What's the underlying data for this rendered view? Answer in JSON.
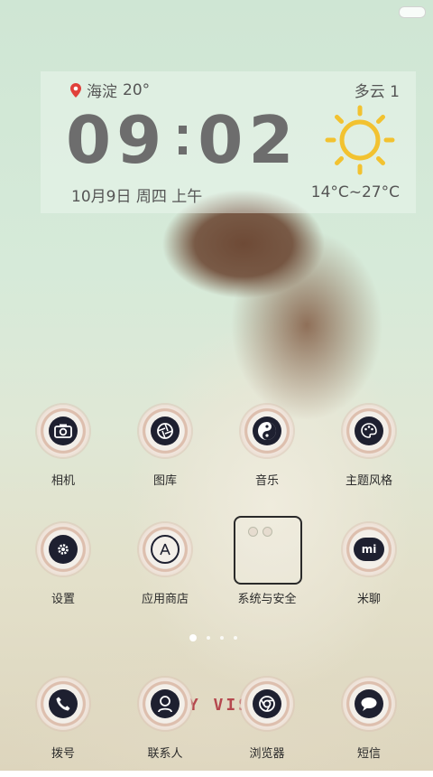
{
  "widget": {
    "location": "海淀",
    "location_temp": "20°",
    "condition": "多云 1",
    "time_h1": "0",
    "time_h2": "9",
    "time_m1": "0",
    "time_m2": "2",
    "date": "10月9日 周四 上午",
    "temp_range": "14°C~27°C",
    "weather_icon": "sun-icon",
    "sun_color": "#f2c230"
  },
  "apps": {
    "camera": "相机",
    "gallery": "图库",
    "music": "音乐",
    "themes": "主题风格",
    "settings": "设置",
    "app_store": "应用商店",
    "system_security": "系统与安全",
    "mi_talk": "米聊",
    "dialer": "拨号",
    "contacts": "联系人",
    "browser": "浏览器",
    "messages": "短信"
  },
  "page_indicator": {
    "pages": 4,
    "current": 1
  },
  "watermark_text": "TY VISI"
}
